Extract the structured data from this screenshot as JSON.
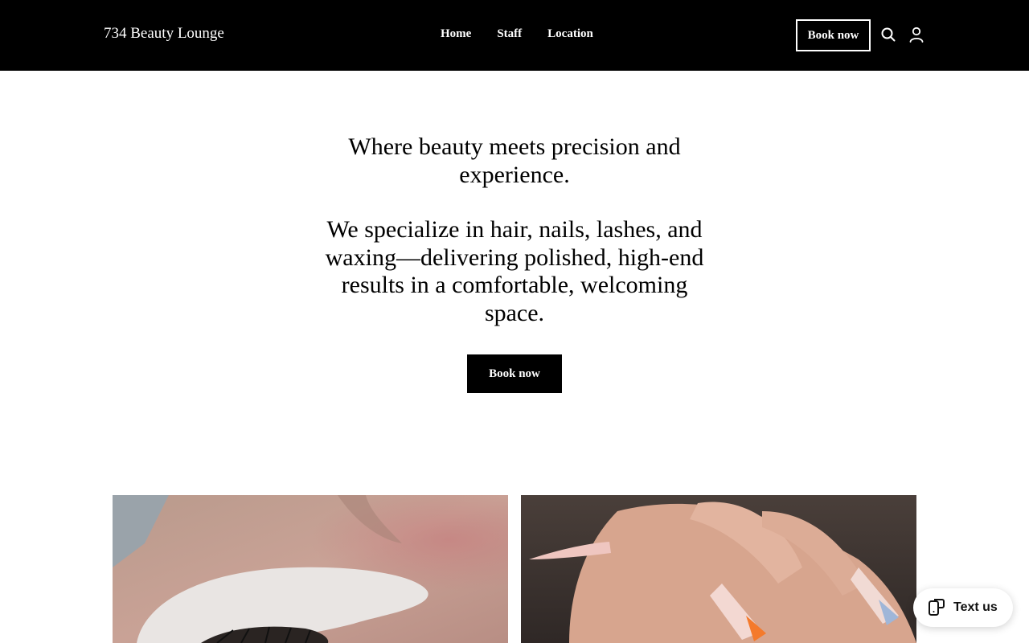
{
  "header": {
    "brand": "734 Beauty Lounge",
    "nav": [
      {
        "label": "Home"
      },
      {
        "label": "Staff"
      },
      {
        "label": "Location"
      }
    ],
    "book_label": "Book now",
    "icons": [
      "search-icon",
      "account-icon"
    ]
  },
  "hero": {
    "line1": "Where beauty meets precision and experience.",
    "line2": "We specialize in hair, nails, lashes, and waxing—delivering polished, high-end results in a comfortable, welcoming space.",
    "button_label": "Book now"
  },
  "gallery": {
    "photos": [
      {
        "subject": "eyelash extension application"
      },
      {
        "subject": "long nude nails with orange tips"
      }
    ]
  },
  "widget": {
    "label": "Text us",
    "icon": "chat-phone-icon"
  },
  "colors": {
    "header_bg": "#000000",
    "accent": "#000000",
    "page_bg": "#ffffff"
  }
}
